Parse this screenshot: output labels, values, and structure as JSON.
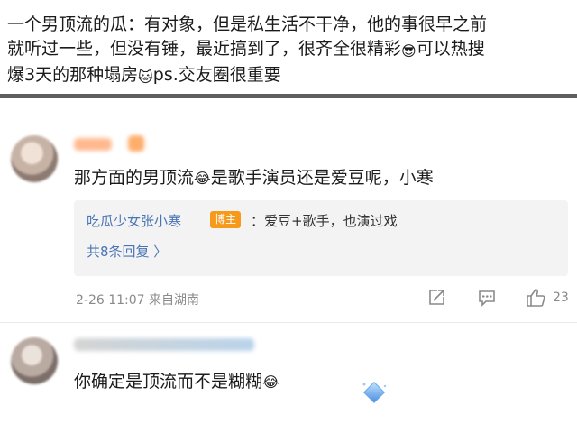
{
  "post": {
    "line1": "一个男顶流的瓜：有对象，但是私生活不干净，他的事很早之前",
    "line2a": "就听过一些，但没有锤，最近搞到了，很齐全很精彩",
    "line2_emoji": "😎",
    "line2b": "可以热搜",
    "line3a": "爆3天的那种塌房",
    "line3_emoji": "🐱",
    "line3b": "ps.交友圈很重要"
  },
  "comment1": {
    "text_a": "那方面的男顶流",
    "emoji": "😂",
    "text_b": "是歌手演员还是爱豆呢，小寒",
    "reply": {
      "user": "吃瓜少女张小寒",
      "badge": "博主",
      "text": "：爱豆+歌手，也演过戏",
      "more": "共8条回复 〉"
    },
    "meta": "2-26 11:07 来自湖南",
    "likes": "23"
  },
  "comment2": {
    "text_a": "你确定是顶流而不是糊糊",
    "emoji": "😂"
  },
  "colors": {
    "link": "#4a74b5",
    "badge": "#f59a1b",
    "separator": "#5e5e5e",
    "meta": "#8a8a8a"
  },
  "icons": [
    "share-icon",
    "comment-icon",
    "like-icon",
    "diamond-badge-icon"
  ]
}
